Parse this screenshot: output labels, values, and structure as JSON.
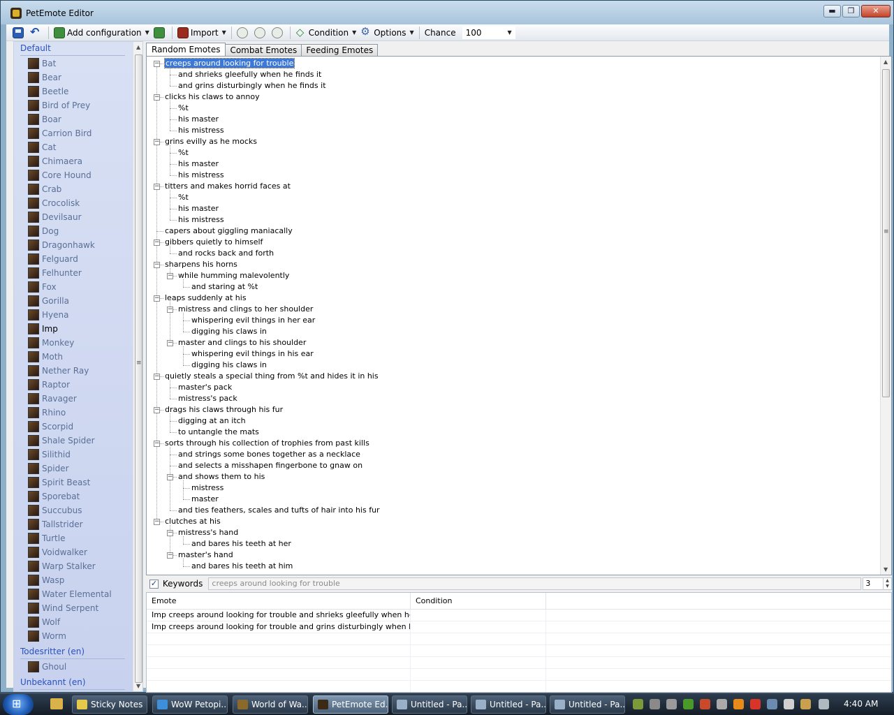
{
  "window": {
    "title": "PetEmote Editor",
    "min": "▬",
    "max": "❐",
    "close": "✕"
  },
  "toolbar": {
    "add_config": "Add configuration",
    "import": "Import",
    "condition": "Condition",
    "options": "Options",
    "chance_label": "Chance",
    "chance_value": "100"
  },
  "sidebar": {
    "groups": [
      {
        "title": "Default"
      },
      {
        "title": "Todesritter (en)"
      },
      {
        "title": "Unbekannt (en)"
      }
    ],
    "default_pets": [
      "Bat",
      "Bear",
      "Beetle",
      "Bird of Prey",
      "Boar",
      "Carrion Bird",
      "Cat",
      "Chimaera",
      "Core Hound",
      "Crab",
      "Crocolisk",
      "Devilsaur",
      "Dog",
      "Dragonhawk",
      "Felguard",
      "Felhunter",
      "Fox",
      "Gorilla",
      "Hyena",
      "Imp",
      "Monkey",
      "Moth",
      "Nether Ray",
      "Raptor",
      "Ravager",
      "Rhino",
      "Scorpid",
      "Shale Spider",
      "Silithid",
      "Spider",
      "Spirit Beast",
      "Sporebat",
      "Succubus",
      "Tallstrider",
      "Turtle",
      "Voidwalker",
      "Warp Stalker",
      "Wasp",
      "Water Elemental",
      "Wind Serpent",
      "Wolf",
      "Worm"
    ],
    "selected_pet": "Imp",
    "dk_pets": [
      "Ghoul"
    ]
  },
  "tabs": [
    "Random Emotes",
    "Combat Emotes",
    "Feeding Emotes"
  ],
  "active_tab": "Random Emotes",
  "tree": [
    {
      "text": "creeps around looking for trouble",
      "level": 0,
      "expanded": true,
      "selected": true
    },
    {
      "text": "and shrieks gleefully when he finds it",
      "level": 1
    },
    {
      "text": "and grins disturbingly when he finds it",
      "level": 1
    },
    {
      "text": "clicks his claws to annoy",
      "level": 0,
      "expanded": true
    },
    {
      "text": "%t",
      "level": 1
    },
    {
      "text": "his master",
      "level": 1
    },
    {
      "text": "his mistress",
      "level": 1
    },
    {
      "text": "grins evilly as he mocks",
      "level": 0,
      "expanded": true
    },
    {
      "text": "%t",
      "level": 1
    },
    {
      "text": "his master",
      "level": 1
    },
    {
      "text": "his mistress",
      "level": 1
    },
    {
      "text": "titters and makes horrid faces at",
      "level": 0,
      "expanded": true
    },
    {
      "text": "%t",
      "level": 1
    },
    {
      "text": "his master",
      "level": 1
    },
    {
      "text": "his mistress",
      "level": 1
    },
    {
      "text": "capers about giggling maniacally",
      "level": 0
    },
    {
      "text": "gibbers quietly to himself",
      "level": 0,
      "expanded": true
    },
    {
      "text": "and rocks back and forth",
      "level": 1
    },
    {
      "text": "sharpens his horns",
      "level": 0,
      "expanded": true
    },
    {
      "text": "while humming malevolently",
      "level": 1,
      "expanded": true
    },
    {
      "text": "and staring at %t",
      "level": 2
    },
    {
      "text": "leaps suddenly at his",
      "level": 0,
      "expanded": true
    },
    {
      "text": "mistress and clings to her shoulder",
      "level": 1,
      "expanded": true
    },
    {
      "text": "whispering evil things in her ear",
      "level": 2
    },
    {
      "text": "digging his claws in",
      "level": 2
    },
    {
      "text": "master and clings to his shoulder",
      "level": 1,
      "expanded": true
    },
    {
      "text": "whispering evil things in his ear",
      "level": 2
    },
    {
      "text": "digging his claws in",
      "level": 2
    },
    {
      "text": "quietly steals a special thing from %t and hides it in his",
      "level": 0,
      "expanded": true
    },
    {
      "text": "master's pack",
      "level": 1
    },
    {
      "text": "mistress's pack",
      "level": 1
    },
    {
      "text": "drags his claws through his fur",
      "level": 0,
      "expanded": true
    },
    {
      "text": "digging at an itch",
      "level": 1
    },
    {
      "text": "to untangle the mats",
      "level": 1
    },
    {
      "text": "sorts through his collection of trophies from past kills",
      "level": 0,
      "expanded": true
    },
    {
      "text": "and strings some bones together as a necklace",
      "level": 1
    },
    {
      "text": "and selects a misshapen fingerbone to gnaw on",
      "level": 1
    },
    {
      "text": "and shows them to his",
      "level": 1,
      "expanded": true
    },
    {
      "text": "mistress",
      "level": 2
    },
    {
      "text": "master",
      "level": 2
    },
    {
      "text": "and ties feathers, scales and tufts of hair into his fur",
      "level": 1
    },
    {
      "text": "clutches at his",
      "level": 0,
      "expanded": true
    },
    {
      "text": "mistress's hand",
      "level": 1,
      "expanded": true
    },
    {
      "text": "and bares his teeth at her",
      "level": 2
    },
    {
      "text": "master's hand",
      "level": 1,
      "expanded": true
    },
    {
      "text": "and bares his teeth at him",
      "level": 2
    }
  ],
  "keywords": {
    "label": "Keywords",
    "checked": "✓",
    "value": "creeps around looking for trouble",
    "count": "3"
  },
  "grid": {
    "columns": [
      "Emote",
      "Condition"
    ],
    "rows": [
      [
        "Imp creeps around looking for trouble and shrieks gleefully when he finds it.",
        ""
      ],
      [
        "Imp creeps around looking for trouble and grins disturbingly when he finds it.",
        ""
      ]
    ]
  },
  "taskbar": {
    "buttons": [
      "Sticky Notes",
      "WoW Petopi...",
      "World of Wa...",
      "PetEmote Ed...",
      "Untitled - Pa...",
      "Untitled - Pa...",
      "Untitled - Pa..."
    ],
    "active": "PetEmote Ed...",
    "clock": "4:40 AM"
  }
}
